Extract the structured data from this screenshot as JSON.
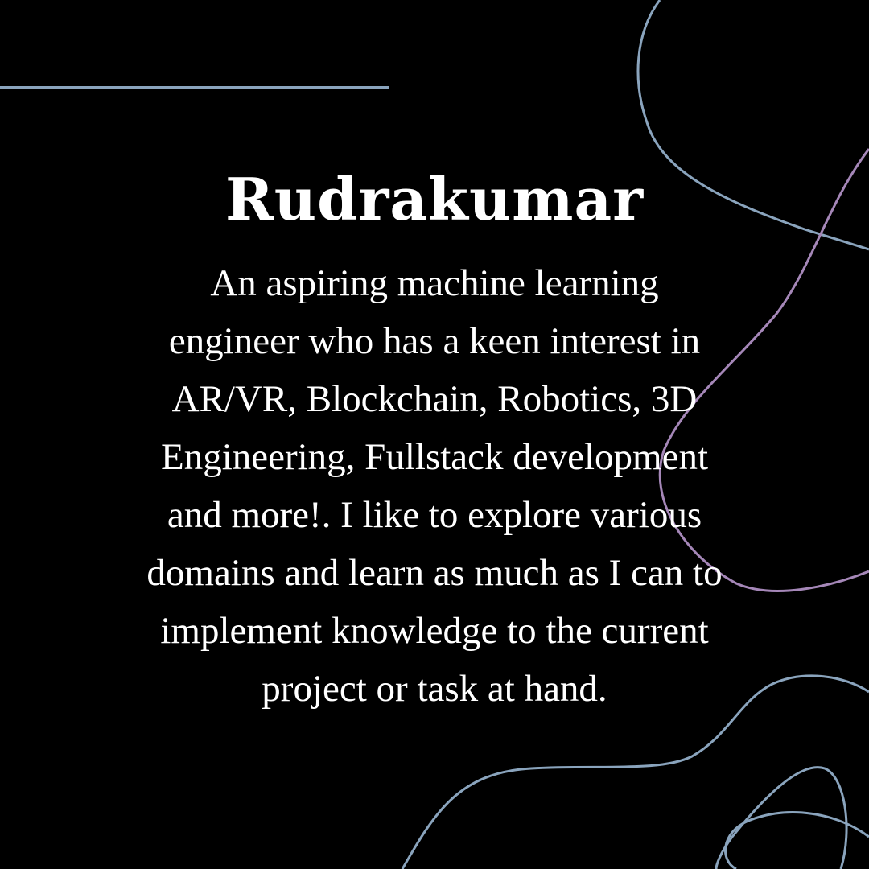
{
  "profile": {
    "name": "Rudrakumar",
    "bio_lines": [
      "An aspiring machine learning",
      "engineer who has a keen interest in",
      "AR/VR, Blockchain, Robotics, 3D",
      "Engineering, Fullstack development",
      "and more!. I like to explore various",
      "domains and learn as much as I can to",
      "implement knowledge to the current",
      "project or task at hand."
    ]
  },
  "colors": {
    "background": "#000000",
    "text": "#ffffff",
    "line_blue": "#8aa4bd",
    "line_purple": "#a587b8"
  }
}
